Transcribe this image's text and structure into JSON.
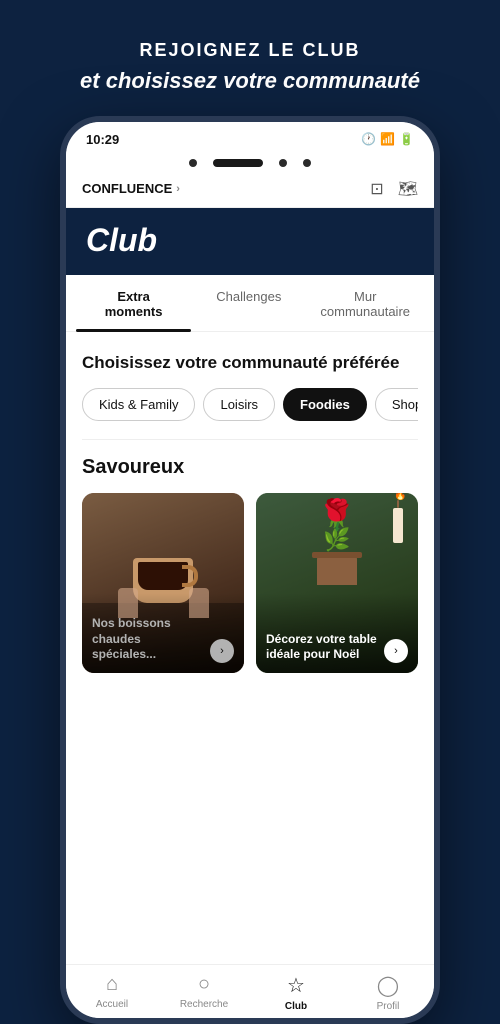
{
  "header": {
    "title": "REJOIGNEZ LE CLUB",
    "subtitle": "et choisissez votre communauté"
  },
  "status_bar": {
    "time": "10:29",
    "icons": [
      "alarm",
      "wifi",
      "signal",
      "battery"
    ]
  },
  "browser": {
    "url": "CONFLUENCE",
    "chevron": "›"
  },
  "app": {
    "title": "Club",
    "tabs": [
      {
        "label": "Extra moments",
        "active": true
      },
      {
        "label": "Challenges",
        "active": false
      },
      {
        "label": "Mur communautaire",
        "active": false
      }
    ],
    "community_section": {
      "heading": "Choisissez votre communauté préférée",
      "chips": [
        {
          "label": "Kids & Family",
          "active": false
        },
        {
          "label": "Loisirs",
          "active": false
        },
        {
          "label": "Foodies",
          "active": true
        },
        {
          "label": "Shoppers",
          "active": false
        }
      ]
    },
    "savoureux_section": {
      "title": "Savoureux",
      "cards": [
        {
          "text": "Nos boissons chaudes spéciales...",
          "arrow": "›"
        },
        {
          "text": "Décorez votre table idéale pour Noël",
          "arrow": "›"
        }
      ]
    },
    "nav": [
      {
        "icon": "⌂",
        "label": "Accueil",
        "active": false
      },
      {
        "icon": "○",
        "label": "Recherche",
        "active": false
      },
      {
        "icon": "☆",
        "label": "Club",
        "active": true
      },
      {
        "icon": "◯",
        "label": "Profil",
        "active": false
      }
    ]
  }
}
